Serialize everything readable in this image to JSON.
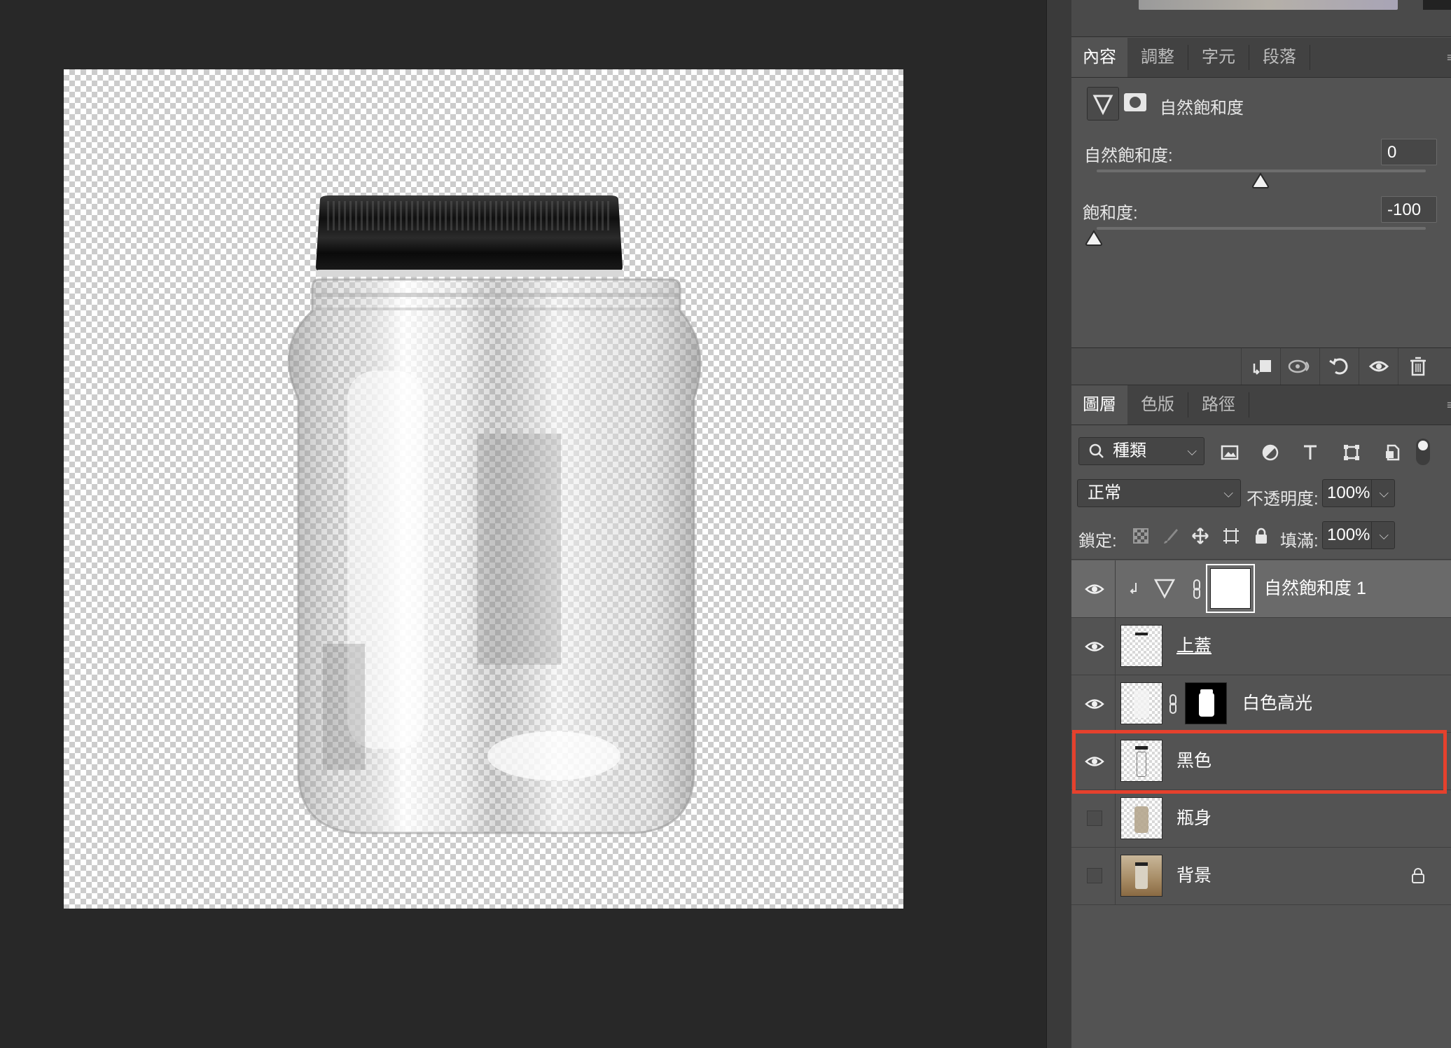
{
  "properties_panel": {
    "tabs": [
      "內容",
      "調整",
      "字元",
      "段落"
    ],
    "active_tab": "內容",
    "adjustment_title": "自然飽和度",
    "vibrance": {
      "label": "自然飽和度:",
      "value": "0"
    },
    "saturation": {
      "label": "飽和度:",
      "value": "-100"
    }
  },
  "layers_panel": {
    "tabs": [
      "圖層",
      "色版",
      "路徑"
    ],
    "active_tab": "圖層",
    "filter_kind": "種類",
    "blend_mode": "正常",
    "opacity_label": "不透明度:",
    "opacity_value": "100%",
    "lock_label": "鎖定:",
    "fill_label": "填滿:",
    "fill_value": "100%",
    "layers": [
      {
        "name": "自然飽和度 1",
        "visible": true,
        "selected": true,
        "type": "adjustment"
      },
      {
        "name": "上蓋",
        "visible": true,
        "selected": false,
        "type": "pixel"
      },
      {
        "name": "白色高光",
        "visible": true,
        "selected": false,
        "type": "masked"
      },
      {
        "name": "黑色",
        "visible": true,
        "selected": false,
        "type": "pixel",
        "highlighted": true
      },
      {
        "name": "瓶身",
        "visible": false,
        "selected": false,
        "type": "pixel"
      },
      {
        "name": "背景",
        "visible": false,
        "selected": false,
        "type": "background",
        "locked": true
      }
    ]
  },
  "colors": {
    "canvas_bg": "#282828",
    "panel_bg": "#535353",
    "selected_layer": "#6a6a6a",
    "annotation_red": "#e5412d"
  },
  "icons": [
    "vibrance-triangle-icon",
    "mask-icon",
    "clip-to-layer-icon",
    "view-previous-icon",
    "reset-icon",
    "visibility-icon",
    "trash-icon",
    "search-icon",
    "image-filter-icon",
    "adjustment-filter-icon",
    "type-filter-icon",
    "shape-filter-icon",
    "smart-object-filter-icon",
    "eye-icon",
    "link-icon",
    "lock-icon"
  ]
}
